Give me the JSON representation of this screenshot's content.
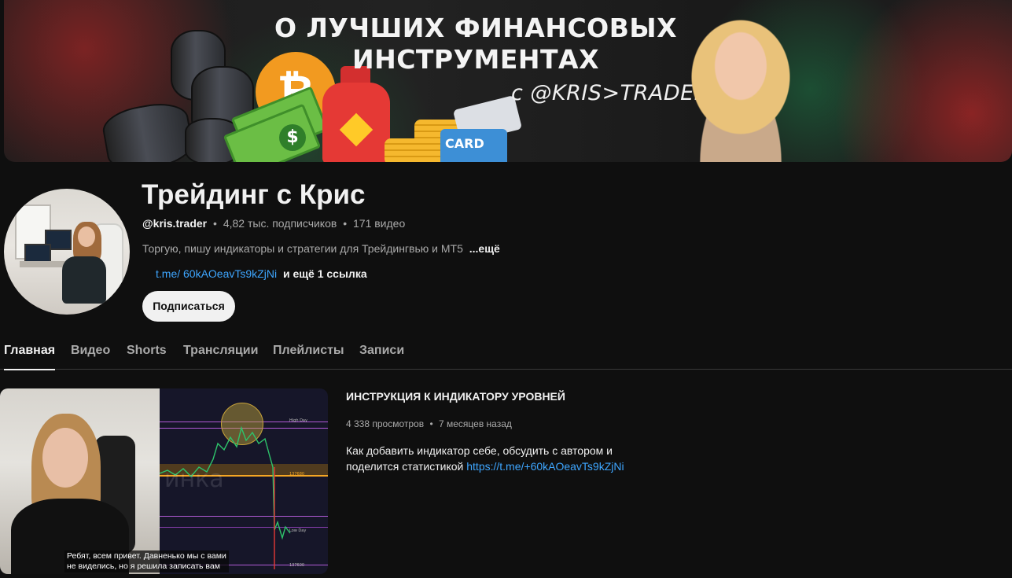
{
  "banner": {
    "title_line1": "О ЛУЧШИХ ФИНАНСОВЫХ",
    "title_line2": "ИНСТРУМЕНТАХ",
    "handle": "с @KRIS>TRADER",
    "card_text": "CARD",
    "bitcoin_symbol": "₿",
    "dollar_symbol": "$"
  },
  "channel": {
    "name": "Трейдинг с Крис",
    "handle": "@kris.trader",
    "subscribers": "4,82 тыс. подписчиков",
    "videos": "171 видео",
    "separator": "•",
    "description": "Торгую, пишу индикаторы и стратегии для Трейдингвью и МТ5",
    "description_more": "...ещё",
    "link": "t.me/ 60kAOeavTs9kZjNi",
    "more_links": "и ещё 1 ссылка",
    "subscribe_label": "Подписаться"
  },
  "tabs": [
    {
      "label": "Главная",
      "active": true
    },
    {
      "label": "Видео",
      "active": false
    },
    {
      "label": "Shorts",
      "active": false
    },
    {
      "label": "Трансляции",
      "active": false
    },
    {
      "label": "Плейлисты",
      "active": false
    },
    {
      "label": "Записи",
      "active": false
    }
  ],
  "featured": {
    "title": "ИНСТРУКЦИЯ К ИНДИКАТОРУ УРОВНЕЙ",
    "views": "4 338 просмотров",
    "age": "7 месяцев назад",
    "description_text": "Как добавить индикатор себе, обсудить с автором и поделится статистикой",
    "description_link": "https://t.me/+60kAOeavTs9kZjNi",
    "caption_line1": "Ребят, всем привет. Давненько мы с вами",
    "caption_line2": "не виделись, но я решила записать вам",
    "chart_watermark": "инка",
    "chart_labels": [
      "High Day",
      "137680",
      "Low Day",
      "137600"
    ]
  },
  "colors": {
    "background": "#0f0f0f",
    "text_primary": "#f1f1f1",
    "text_secondary": "#aaaaaa",
    "link": "#3ea6ff",
    "subscribe_bg": "#f1f1f1"
  }
}
